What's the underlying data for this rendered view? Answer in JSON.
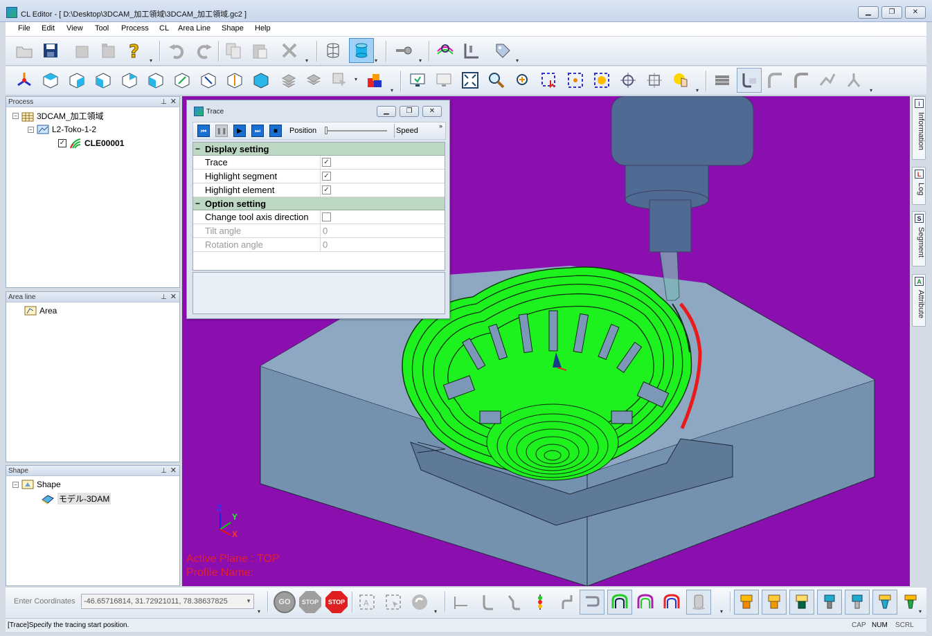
{
  "window": {
    "app_name": "CL Editor",
    "title": "CL Editor - [ D:\\Desktop\\3DCAM_加工領域\\3DCAM_加工領域.gc2 ]"
  },
  "menu": [
    "File",
    "Edit",
    "View",
    "Tool",
    "Process",
    "CL",
    "Area Line",
    "Shape",
    "Help"
  ],
  "toolbar1": [
    "open-folder-icon",
    "save-icon",
    "save-disabled-icon",
    "save-as-icon",
    "help-icon",
    "undo-icon",
    "redo-icon",
    "copy-icon",
    "paste-icon",
    "delete-icon",
    "wireframe-cylinder-icon",
    "solid-cylinder-icon",
    "key-icon",
    "search-color-icon",
    "ruler-icon",
    "tag-icon"
  ],
  "toolbar2": [
    "view-axes-icon",
    "view-top-icon",
    "view-front-icon",
    "view-right-icon",
    "view-left-icon",
    "view-back-icon",
    "view-iso1-icon",
    "view-iso2-icon",
    "view-iso3-icon",
    "view-iso4-icon",
    "layers-icon",
    "layers-stack-icon",
    "select-icon",
    "color-icon",
    "monitor-icon",
    "monitor-refresh-icon",
    "zoom-fit-icon",
    "zoom-icon",
    "zoom-in-icon",
    "zoom-window-icon",
    "zoom-center-icon",
    "zoom-sun-icon",
    "crosshair-icon",
    "crosshair-alt-icon",
    "pan-hand-icon",
    "stack-lines-icon",
    "tool-path-icon",
    "path-a-icon",
    "path-b-icon",
    "path-c-icon",
    "path-d-icon"
  ],
  "panes": {
    "process": {
      "title": "Process",
      "items": [
        {
          "label": "3DCAM_加工領域",
          "level": 0
        },
        {
          "label": "L2-Toko-1-2",
          "level": 1
        },
        {
          "label": "CLE00001",
          "level": 2,
          "checked": true
        }
      ]
    },
    "area_line": {
      "title": "Area line",
      "items": [
        {
          "label": "Area"
        }
      ]
    },
    "shape": {
      "title": "Shape",
      "items": [
        {
          "label": "Shape"
        },
        {
          "label": "モデル-3DAM"
        }
      ]
    }
  },
  "trace": {
    "title": "Trace",
    "position_label": "Position",
    "position_value": 0,
    "speed_label": "Speed",
    "controls": [
      "first-icon",
      "pause-icon",
      "play-icon",
      "last-icon",
      "stop-icon"
    ],
    "display_setting": "Display setting",
    "option_setting": "Option setting",
    "trace_label": "Trace",
    "trace_checked": true,
    "highlight_segment_label": "Highlight segment",
    "highlight_segment_checked": true,
    "highlight_element_label": "Highlight element",
    "highlight_element_checked": true,
    "change_axis_label": "Change tool axis direction",
    "change_axis_checked": false,
    "tilt_label": "Tilt angle",
    "tilt_value": "0",
    "rotation_label": "Rotation angle",
    "rotation_value": "0"
  },
  "viewport": {
    "active_plane": "Active Plane : TOP",
    "profile_name": "Profile Name:",
    "axis_x": "X",
    "axis_y": "Y",
    "axis_z": "Z",
    "colors": {
      "background": "#8a0fae",
      "stock": "#7591b0",
      "toolpath": "#1ef21e",
      "highlight": "#e81a1a",
      "tool": "#3d8a8a"
    }
  },
  "side_tabs": [
    "Information",
    "Log",
    "Segment",
    "Attribute"
  ],
  "side_tab_icons": [
    "i",
    "L",
    "S",
    "A"
  ],
  "coords": {
    "label": "Enter Coordinates",
    "value": "-46.65716814, 31.72921011, 78.38637825"
  },
  "bottom_buttons": {
    "go": "GO",
    "stop": "STOP",
    "stop_red": "STOP"
  },
  "status": {
    "message": "[Trace]Specify the tracing start position.",
    "cap": "CAP",
    "num": "NUM",
    "scrl": "SCRL"
  }
}
